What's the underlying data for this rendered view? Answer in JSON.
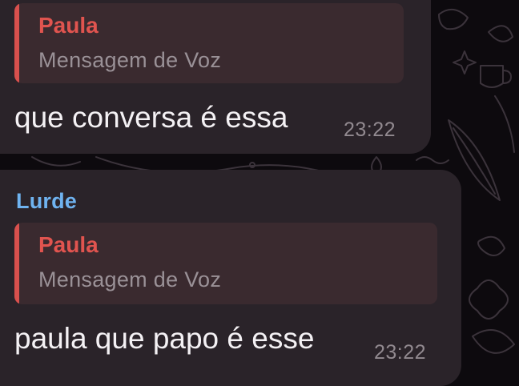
{
  "messages": [
    {
      "sender": "",
      "reply": {
        "author": "Paula",
        "text": "Mensagem de Voz"
      },
      "text": "que conversa é essa",
      "time": "23:22"
    },
    {
      "sender": "Lurde",
      "reply": {
        "author": "Paula",
        "text": "Mensagem de Voz"
      },
      "text": "paula que papo é esse",
      "time": "23:22"
    }
  ],
  "colors": {
    "background": "#0d0a0e",
    "bubble": "#2a2329",
    "reply_background": "#3a2a2f",
    "reply_bar": "#d8504d",
    "reply_author": "#e0544f",
    "sender_name": "#6fb3f0",
    "message_text": "#f4f1f4",
    "meta_text": "#928a90"
  }
}
